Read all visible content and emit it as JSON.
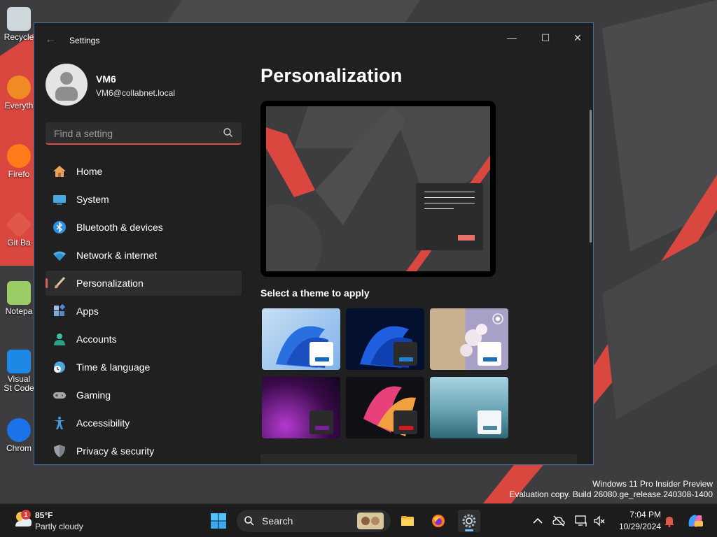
{
  "desktop": {
    "icons": [
      {
        "name": "recycle-bin",
        "label": "Recycle"
      },
      {
        "name": "everything",
        "label": "Everyth"
      },
      {
        "name": "firefox",
        "label": "Firefo"
      },
      {
        "name": "git-bash",
        "label": "Git Ba"
      },
      {
        "name": "notepad",
        "label": "Notepa"
      },
      {
        "name": "visual-studio-code",
        "label": "Visual St Code"
      },
      {
        "name": "chrome",
        "label": "Chrom"
      }
    ],
    "watermark_line1": "Windows 11 Pro Insider Preview",
    "watermark_line2": "Evaluation copy. Build 26080.ge_release.240308-1400"
  },
  "window": {
    "title": "Settings",
    "back_icon": "arrow-left-icon",
    "controls": {
      "minimize": "—",
      "maximize": "☐",
      "close": "✕"
    }
  },
  "profile": {
    "name": "VM6",
    "email": "VM6@collabnet.local"
  },
  "search": {
    "placeholder": "Find a setting"
  },
  "nav": {
    "items": [
      {
        "id": "home",
        "label": "Home",
        "icon": "home-icon",
        "color": "#e8a35a"
      },
      {
        "id": "system",
        "label": "System",
        "icon": "monitor-icon",
        "color": "#4aa8e0"
      },
      {
        "id": "bluetooth",
        "label": "Bluetooth & devices",
        "icon": "bluetooth-icon",
        "color": "#2f8fe0"
      },
      {
        "id": "network",
        "label": "Network & internet",
        "icon": "wifi-icon",
        "color": "#4ab0e8"
      },
      {
        "id": "personalization",
        "label": "Personalization",
        "icon": "brush-icon",
        "color": "#e0a070",
        "active": true
      },
      {
        "id": "apps",
        "label": "Apps",
        "icon": "apps-icon",
        "color": "#7fa8d8"
      },
      {
        "id": "accounts",
        "label": "Accounts",
        "icon": "person-icon",
        "color": "#3cc0a8"
      },
      {
        "id": "time",
        "label": "Time & language",
        "icon": "clock-globe-icon",
        "color": "#4aa8e0"
      },
      {
        "id": "gaming",
        "label": "Gaming",
        "icon": "gamepad-icon",
        "color": "#a8a8a8"
      },
      {
        "id": "accessibility",
        "label": "Accessibility",
        "icon": "accessibility-icon",
        "color": "#3f9ae0"
      },
      {
        "id": "privacy",
        "label": "Privacy & security",
        "icon": "shield-icon",
        "color": "#9aa0a8"
      }
    ]
  },
  "content": {
    "title": "Personalization",
    "theme_section_label": "Select a theme to apply",
    "themes": [
      {
        "name": "windows-light",
        "accent": "#0f6cbd"
      },
      {
        "name": "windows-dark",
        "accent": "#1f7fd0"
      },
      {
        "name": "glow",
        "accent": "#1f6fb8"
      },
      {
        "name": "captured-motion",
        "accent": "#7b1fa2"
      },
      {
        "name": "flow",
        "accent": "#d41c1c"
      },
      {
        "name": "sunrise",
        "accent": "#4a8a9a"
      }
    ]
  },
  "taskbar": {
    "weather": {
      "badge": "1",
      "temp": "85°F",
      "condition": "Partly cloudy"
    },
    "search_label": "Search",
    "apps": [
      "file-explorer-icon",
      "firefox-icon",
      "settings-icon"
    ],
    "tray": [
      "chevron-up-icon",
      "cloud-off-icon",
      "network-icon",
      "volume-mute-icon"
    ],
    "time": "7:04 PM",
    "date": "10/29/2024"
  },
  "colors": {
    "accent": "#e04a4a",
    "window_bg": "#202020",
    "taskbar_bg": "#1c1c1c"
  }
}
